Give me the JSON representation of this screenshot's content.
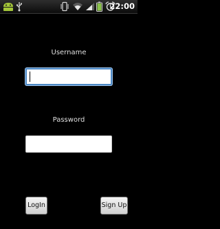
{
  "status_bar": {
    "time": "22:00",
    "icons": [
      "android-notification-icon",
      "usb-icon",
      "vibrate-icon",
      "wifi-icon",
      "signal-icon",
      "battery-icon",
      "alarm-icon"
    ],
    "accent_color": "#8bc34a"
  },
  "form": {
    "username": {
      "label": "Username",
      "value": "",
      "focused": true
    },
    "password": {
      "label": "Password",
      "value": ""
    }
  },
  "buttons": {
    "login_label": "LogIn",
    "signup_label": "Sign Up"
  },
  "colors": {
    "background": "#000000",
    "focus_border": "#4c88c4"
  }
}
